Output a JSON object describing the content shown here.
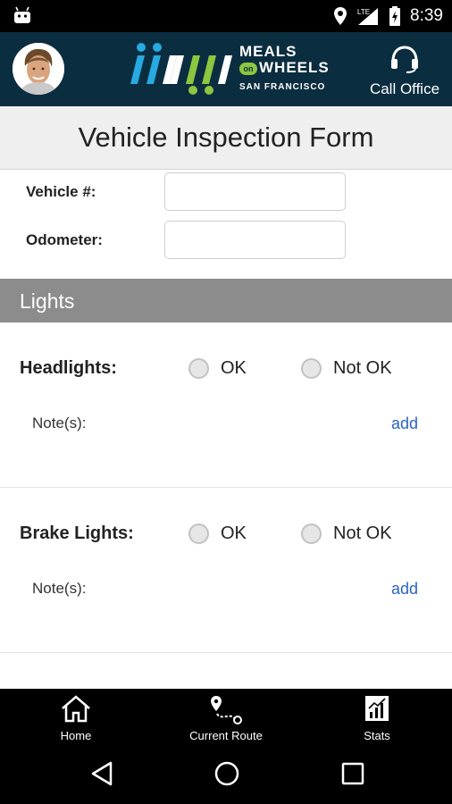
{
  "status_bar": {
    "time": "8:39",
    "network": "LTE"
  },
  "header": {
    "logo_line1": "MEALS",
    "logo_on": "on",
    "logo_line2": "WHEELS",
    "logo_line3": "SAN FRANCISCO",
    "call_office_label": "Call Office"
  },
  "page": {
    "title": "Vehicle Inspection Form"
  },
  "vehicle_fields": [
    {
      "label": "Vehicle #:",
      "value": ""
    },
    {
      "label": "Odometer:",
      "value": ""
    }
  ],
  "section": {
    "title": "Lights"
  },
  "items": [
    {
      "label": "Headlights:",
      "ok_label": "OK",
      "not_ok_label": "Not OK",
      "notes_label": "Note(s):",
      "add_label": "add"
    },
    {
      "label": "Brake Lights:",
      "ok_label": "OK",
      "not_ok_label": "Not OK",
      "notes_label": "Note(s):",
      "add_label": "add"
    }
  ],
  "bottom_nav": [
    {
      "label": "Home",
      "icon": "home-icon"
    },
    {
      "label": "Current Route",
      "icon": "route-icon"
    },
    {
      "label": "Stats",
      "icon": "stats-icon"
    }
  ],
  "colors": {
    "header_bg": "#0b2d40",
    "logo_blue": "#27a9e1",
    "logo_green": "#8dc63f",
    "section_bg": "#8c8c8c",
    "link": "#2d62c4"
  }
}
